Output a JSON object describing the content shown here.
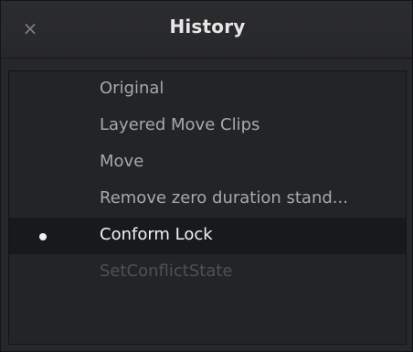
{
  "window": {
    "title": "History",
    "close_symbol": "×",
    "close_icon": "close-icon"
  },
  "history": {
    "items": [
      {
        "label": "Original",
        "state": "past"
      },
      {
        "label": "Layered Move Clips",
        "state": "past"
      },
      {
        "label": "Move",
        "state": "past"
      },
      {
        "label": "Remove zero duration stand...",
        "state": "past"
      },
      {
        "label": "Conform Lock",
        "state": "current"
      },
      {
        "label": "SetConflictState",
        "state": "future"
      }
    ]
  },
  "colors": {
    "background": "#262729",
    "list_background": "#232427",
    "selected_row": "#18191b",
    "text": "#a7a8aa",
    "selected_text": "#f2f2f3",
    "disabled_text": "#4f5154"
  }
}
